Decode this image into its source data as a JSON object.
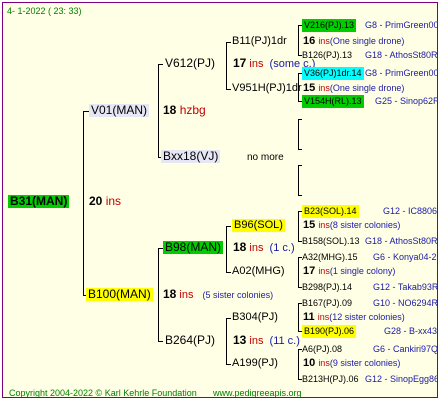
{
  "header": {
    "date": "4-  1-2022 ( 23: 33)"
  },
  "root": {
    "name": "B31(MAN)",
    "num": "20",
    "suffix": "ins"
  },
  "gen1": {
    "upper": {
      "name": "V01(MAN)",
      "num": "18",
      "note": "hzbg"
    },
    "lower": {
      "name": "B100(MAN)",
      "num": "18",
      "suffix": "ins",
      "note": "(5 sister colonies)"
    }
  },
  "gen2": {
    "a": {
      "name": "V612(PJ)",
      "num": "17",
      "suffix": "ins",
      "note": "(some c.)"
    },
    "b": {
      "name": "Bxx18(VJ)",
      "note": "no more"
    },
    "c": {
      "name": "B98(MAN)",
      "num": "18",
      "suffix": "ins",
      "note": "(1 c.)"
    },
    "d": {
      "name": "B264(PJ)",
      "num": "13",
      "suffix": "ins",
      "note": "(11 c.)"
    }
  },
  "gen3": {
    "a1": {
      "name": "B11(PJ)1dr",
      "num": "16",
      "suffix": "ins",
      "note": "(One single drone)"
    },
    "a2": {
      "name": "V951H(PJ)1dr",
      "num": "15",
      "suffix": "ins",
      "note": "(One single drone)"
    },
    "c1": {
      "name": "B96(SOL)",
      "num": "15",
      "suffix": "ins",
      "note": "(8 sister colonies)"
    },
    "c2": {
      "name": "A02(MHG)",
      "num": "17",
      "suffix": "ins",
      "note": "(1 single colony)"
    },
    "d1": {
      "name": "B304(PJ)",
      "num": "11",
      "suffix": "ins",
      "note": "(12 sister colonies)"
    },
    "d2": {
      "name": "A199(PJ)",
      "num": "10",
      "suffix": "ins",
      "note": "(9 sister colonies)"
    }
  },
  "gen4": {
    "r1": {
      "name": "V216(PJ).13",
      "code": "G8 - PrimGreen00"
    },
    "r2": {
      "name": "B126(PJ).13",
      "code": "G18 - AthosSt80R"
    },
    "r3": {
      "name": "V36(PJ)1dr.14",
      "code": "G8 - PrimGreen00"
    },
    "r4": {
      "name": "V154H(RL).13",
      "code": "G25 - Sinop62R"
    },
    "r5": {
      "name": "B23(SOL).14",
      "code": "G12 - IC8806"
    },
    "r6": {
      "name": "B158(SOL).13",
      "code": "G18 - AthosSt80R"
    },
    "r7": {
      "name": "A32(MHG).15",
      "code": "G6 - Konya04-2"
    },
    "r8": {
      "name": "B298(PJ).14",
      "code": "G12 - Takab93R"
    },
    "r9": {
      "name": "B167(PJ).09",
      "code": "G10 - NO6294R"
    },
    "r10": {
      "name": "B190(PJ).06",
      "code": "G28 - B-xx43"
    },
    "r11": {
      "name": "A6(PJ).08",
      "code": "G6 - Cankiri97Q"
    },
    "r12": {
      "name": "B213H(PJ).06",
      "code": "G12 - SinopEgg86R"
    }
  },
  "footer": {
    "copyright": "Copyright 2004-2022 © Karl Kehrle Foundation",
    "site": "www.pedigreeapis.org"
  },
  "colors": {
    "border": "#7f007f",
    "highlight_green": "#00cc00",
    "highlight_yellow": "#ffff00",
    "highlight_cyan": "#00ffff"
  }
}
